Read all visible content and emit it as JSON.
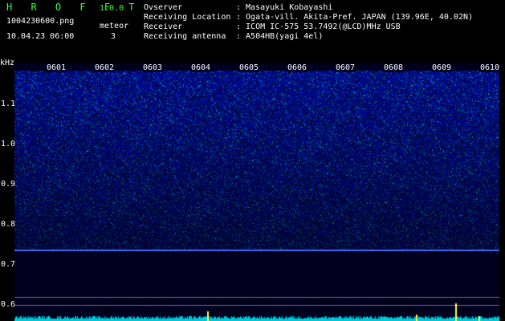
{
  "header": {
    "logo": "H R O F F T",
    "version": "1.0.0",
    "file_name": "1004230600.png",
    "datetime": "10.04.23 06:00",
    "meteor_label": "meteor",
    "meteor_count": "3",
    "info_labels": [
      "Ovserver",
      "Receiving Location",
      "Receiver",
      "Receiving antenna"
    ],
    "info_values": [
      ": Masayuki Kobayashi",
      ": Ogata-vill. Akita-Pref. JAPAN (139.96E, 40.02N)",
      ": ICOM IC-575 53.7492(@LCD)MHz USB",
      ": A504HB(yagi 4el)"
    ]
  },
  "axes": {
    "y_unit": "kHz",
    "y_ticks": [
      "1.1",
      "1.0",
      "0.9",
      "0.8",
      "0.7",
      "0.6"
    ],
    "x_ticks": [
      "0601",
      "0602",
      "0603",
      "0604",
      "0605",
      "0606",
      "0607",
      "0608",
      "0609",
      "0610"
    ]
  },
  "colors": {
    "logo": "#33ff33",
    "spectrum_base": "#06067a",
    "carrier_line": "#4a66ff",
    "trace": "#00c8d8",
    "marker": "#ffff40"
  }
}
